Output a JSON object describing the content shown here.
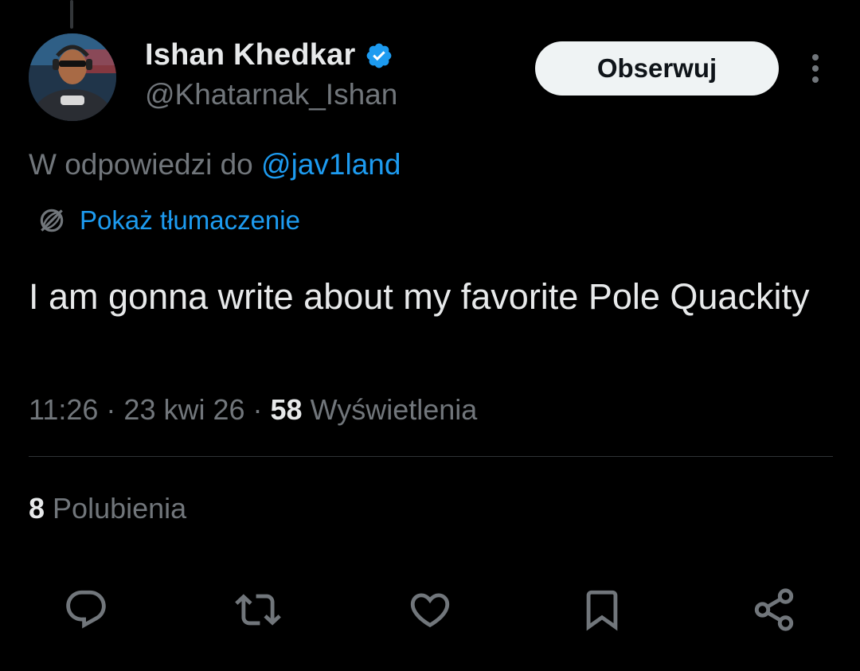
{
  "author": {
    "display_name": "Ishan Khedkar",
    "handle": "@Khatarnak_Ishan",
    "verified": true
  },
  "follow_label": "Obserwuj",
  "reply_to": {
    "prefix": "W odpowiedzi do ",
    "mention": "@jav1land"
  },
  "translate_label": "Pokaż tłumaczenie",
  "tweet_text": "I am gonna write about my favorite Pole Quackity",
  "meta": {
    "time": "11:26",
    "separator": " · ",
    "date": "23 kwi 26",
    "views_count": "58",
    "views_label": " Wyświetlenia"
  },
  "likes": {
    "count": "8",
    "label": " Polubienia"
  },
  "actions": [
    "reply-icon",
    "retweet-icon",
    "like-icon",
    "bookmark-icon",
    "share-icon"
  ],
  "colors": {
    "background": "#000000",
    "text_primary": "#e7e9ea",
    "text_secondary": "#71767b",
    "accent": "#1d9bf0",
    "follow_bg": "#eff3f4"
  }
}
